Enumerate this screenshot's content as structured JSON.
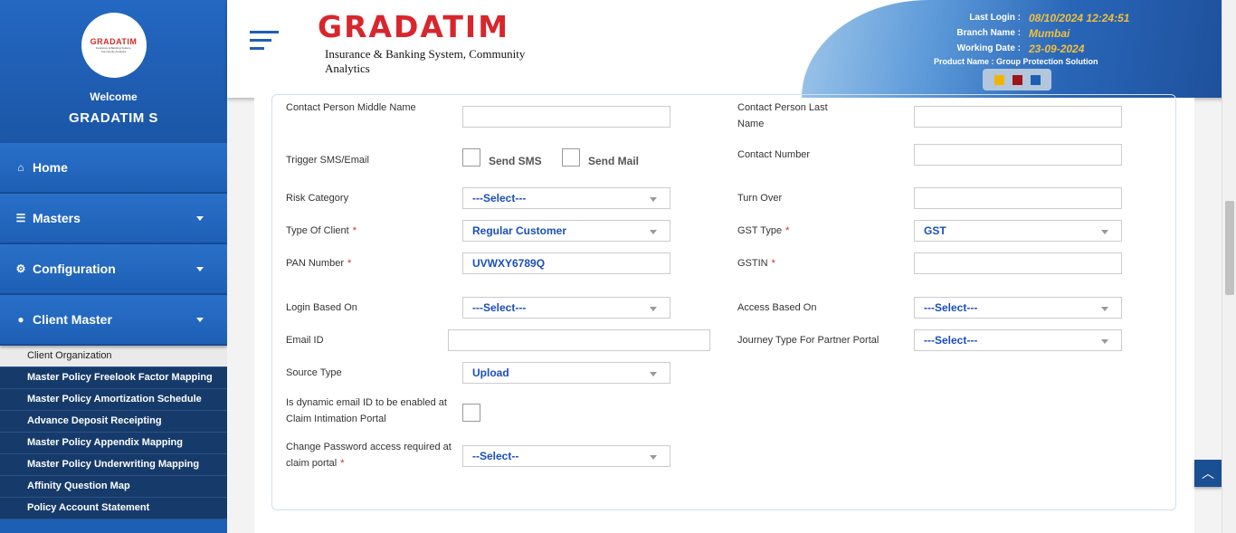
{
  "sidebar": {
    "logo_text": "GRADATIM",
    "logo_sub": "Insurance & Banking System, Community Analytics",
    "welcome": "Welcome",
    "username": "GRADATIM S",
    "menu": [
      {
        "label": "Home",
        "icon": "home-icon"
      },
      {
        "label": "Masters",
        "icon": "database-icon"
      },
      {
        "label": "Configuration",
        "icon": "gears-icon"
      },
      {
        "label": "Client Master",
        "icon": "user-icon"
      }
    ],
    "submenu": [
      "Client Organization",
      "Master Policy Freelook Factor Mapping",
      "Master Policy Amortization Schedule",
      "Advance Deposit Receipting",
      "Master Policy Appendix Mapping",
      "Master Policy Underwriting Mapping",
      "Affinity Question Map",
      "Policy Account Statement"
    ]
  },
  "header": {
    "logo_title": "GRADATIM",
    "logo_tagline": "Insurance & Banking System, Community Analytics",
    "last_login_label": "Last Login :",
    "last_login": "08/10/2024 12:24:51",
    "branch_label": "Branch Name :",
    "branch": "Mumbai",
    "working_date_label": "Working Date :",
    "working_date": "23-09-2024",
    "product_name": "Product Name : Group Protection Solution",
    "theme_colors": [
      "#f0b400",
      "#a01515",
      "#1d5fb5"
    ]
  },
  "form": {
    "contact_middle_label": "Contact Person Middle Name",
    "contact_middle_value": "",
    "contact_last_label": "Contact Person Last Name",
    "contact_last_value": "",
    "trigger_label": "Trigger SMS/Email",
    "send_sms": "Send SMS",
    "send_mail": "Send Mail",
    "contact_number_label": "Contact Number",
    "contact_number_value": "",
    "risk_category_label": "Risk Category",
    "risk_category_value": "---Select---",
    "turn_over_label": "Turn Over",
    "turn_over_value": "",
    "type_of_client_label": "Type Of Client",
    "type_of_client_value": "Regular Customer",
    "gst_type_label": "GST Type",
    "gst_type_value": "GST",
    "pan_label": "PAN Number",
    "pan_value": "UVWXY6789Q",
    "gstin_label": "GSTIN",
    "gstin_value": "",
    "login_based_label": "Login Based On",
    "login_based_value": "---Select---",
    "access_based_label": "Access Based On",
    "access_based_value": "---Select---",
    "email_label": "Email ID",
    "email_value": "",
    "journey_label": "Journey Type For Partner Portal",
    "journey_value": "---Select---",
    "source_type_label": "Source Type",
    "source_type_value": "Upload",
    "dynamic_email_label": "Is dynamic email ID to be enabled at Claim Intimation Portal",
    "change_pwd_label": "Change Password access required at claim portal",
    "change_pwd_value": "--Select--",
    "required_mark": "*"
  }
}
